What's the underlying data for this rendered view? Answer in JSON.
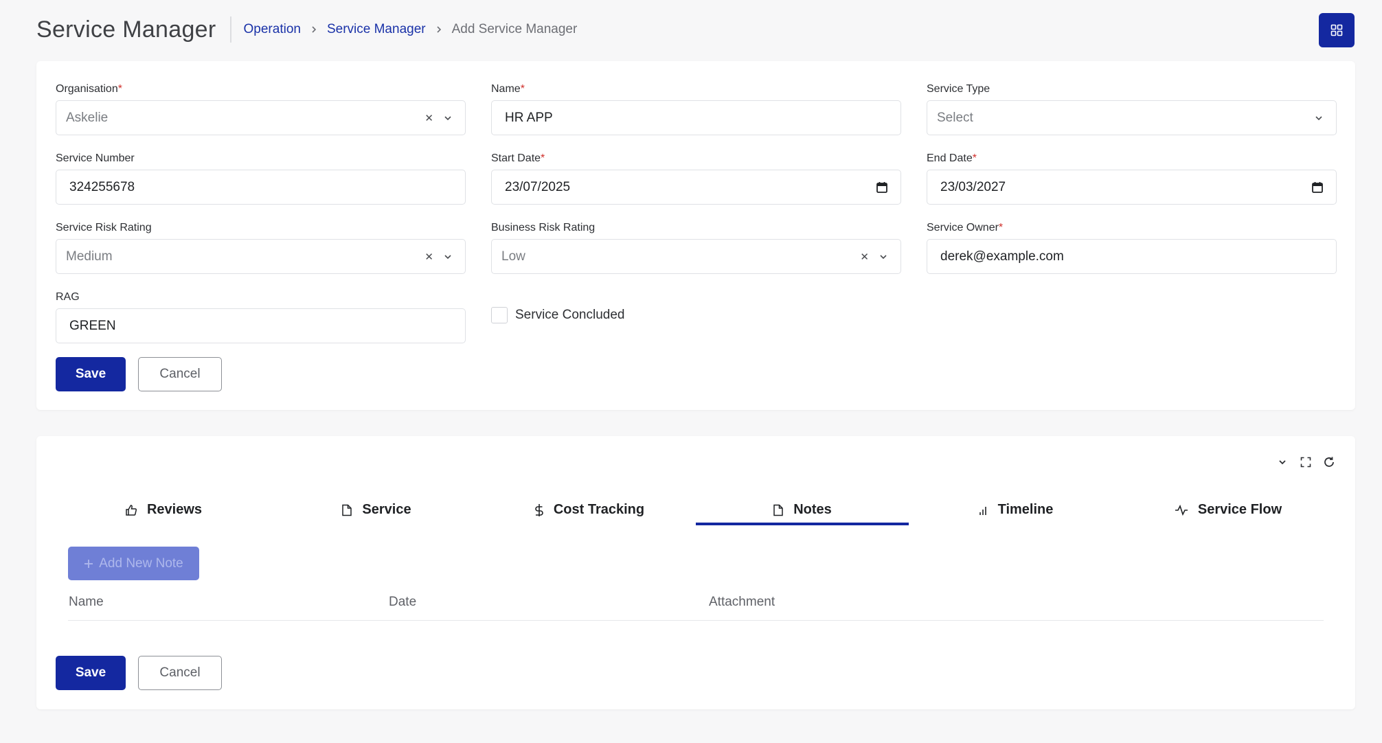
{
  "header": {
    "title": "Service Manager",
    "breadcrumb": [
      "Operation",
      "Service Manager",
      "Add Service Manager"
    ]
  },
  "form": {
    "organisation": {
      "label": "Organisation",
      "value": "Askelie"
    },
    "name": {
      "label": "Name",
      "value": "HR APP"
    },
    "service_type": {
      "label": "Service Type",
      "placeholder": "Select"
    },
    "service_number": {
      "label": "Service Number",
      "value": "324255678"
    },
    "start_date": {
      "label": "Start Date",
      "value": "23/07/2025"
    },
    "end_date": {
      "label": "End Date",
      "value": "23/03/2027"
    },
    "service_risk_rating": {
      "label": "Service Risk Rating",
      "value": "Medium"
    },
    "business_risk_rating": {
      "label": "Business Risk Rating",
      "value": "Low"
    },
    "service_owner": {
      "label": "Service Owner",
      "value": "derek@example.com"
    },
    "rag": {
      "label": "RAG",
      "value": "GREEN"
    },
    "service_concluded": {
      "label": "Service Concluded",
      "checked": false
    },
    "required_mark": "*",
    "clear_glyph": "✕",
    "save_label": "Save",
    "cancel_label": "Cancel"
  },
  "tabs": {
    "items": [
      {
        "label": "Reviews",
        "icon": "thumbs-up-icon"
      },
      {
        "label": "Service",
        "icon": "file-icon"
      },
      {
        "label": "Cost Tracking",
        "icon": "dollar-icon"
      },
      {
        "label": "Notes",
        "icon": "file-icon",
        "active": true
      },
      {
        "label": "Timeline",
        "icon": "bar-chart-icon"
      },
      {
        "label": "Service Flow",
        "icon": "activity-icon"
      }
    ],
    "add_note_label": "Add New Note",
    "table_headers": [
      "Name",
      "Date",
      "Attachment"
    ],
    "save_label": "Save",
    "cancel_label": "Cancel"
  },
  "colors": {
    "primary": "#1428a0",
    "required": "#d0302b",
    "add_note_bg": "#6f7fd6"
  }
}
